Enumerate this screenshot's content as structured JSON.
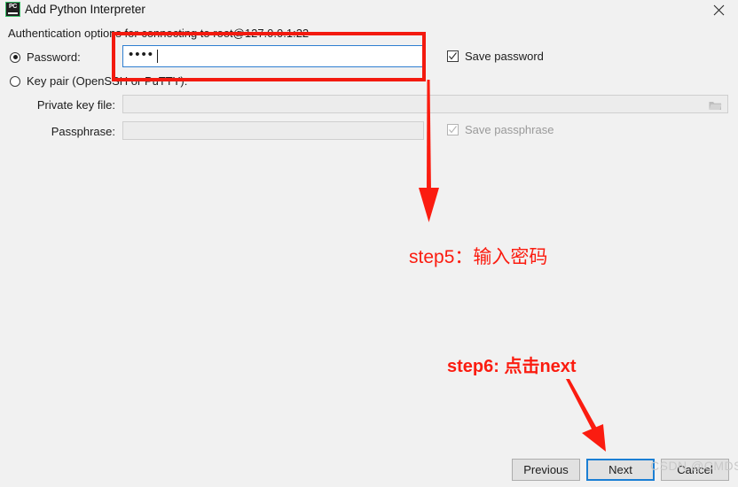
{
  "window": {
    "title": "Add Python Interpreter",
    "icon": "pycharm-icon",
    "icon_text": "PC",
    "close_icon": "close-icon"
  },
  "form": {
    "header": "Authentication options for connecting to root@127.0.0.1:22",
    "auth_mode_selected": "password",
    "options": [
      {
        "id": "password",
        "label": "Password:",
        "selected": true
      },
      {
        "id": "keypair",
        "label": "Key pair (OpenSSH or PuTTY):",
        "selected": false
      }
    ],
    "password": {
      "label": "Password:",
      "value": "••••",
      "masked_char_count": 4,
      "focused": true
    },
    "save_password": {
      "label": "Save password",
      "checked": true,
      "enabled": true
    },
    "private_key_file": {
      "label": "Private key file:",
      "value": "",
      "enabled": false,
      "browse_icon": "folder-icon"
    },
    "passphrase": {
      "label": "Passphrase:",
      "value": "",
      "enabled": false
    },
    "save_passphrase": {
      "label": "Save passphrase",
      "checked": true,
      "enabled": false
    }
  },
  "annotations": {
    "accent_color": "#fb1c10",
    "step5": {
      "text": "step5：输入密码",
      "arrow": "down-arrow",
      "highlight": "red-rectangle-around-password-field"
    },
    "step6": {
      "text": "step6: 点击next",
      "arrow": "diagonal-down-right-arrow"
    }
  },
  "footer": {
    "buttons": [
      {
        "id": "previous",
        "label": "Previous",
        "default": false
      },
      {
        "id": "next",
        "label": "Next",
        "default": true
      },
      {
        "id": "cancel",
        "label": "Cancel",
        "default": false
      }
    ]
  },
  "watermark": {
    "text": "CSDN @CMDST"
  },
  "colors": {
    "dialog_background": "#f1f1f1",
    "focus_blue": "#2f7fd1",
    "default_button_blue": "#1b7fd4",
    "annotation_red": "#fb1c10",
    "highlight_rect_red": "#f31a0f"
  }
}
